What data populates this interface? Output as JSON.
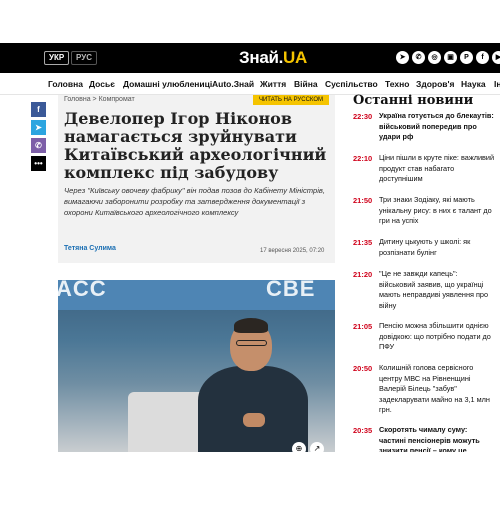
{
  "header": {
    "lang_active": "УКР",
    "lang_inactive": "РУС",
    "logo_main": "Знай.",
    "logo_accent": "UA",
    "social_icons": [
      "telegram-icon",
      "viber-icon",
      "instagram-icon",
      "flipboard-icon",
      "pinterest-icon",
      "facebook-icon",
      "youtube-icon"
    ]
  },
  "nav": {
    "items": [
      "Головна",
      "Досьє",
      "Домашні улюблениці",
      "Auto.Знай",
      "Життя",
      "Війна",
      "Суспільство",
      "Техно",
      "Здоров'я",
      "Наука",
      "Ін"
    ]
  },
  "share": {
    "icons": [
      "facebook-icon",
      "telegram-icon",
      "viber-icon",
      "more-icon"
    ],
    "colors": [
      "#3b5998",
      "#2ca5e0",
      "#7d5fa8",
      "#000000"
    ]
  },
  "article": {
    "breadcrumb_home": "Головна",
    "breadcrumb_sep": " > ",
    "breadcrumb_section": "Компромат",
    "ru_button": "ЧИТАТЬ НА РУССКОМ",
    "title": "Девелопер Ігор Ніконов намагається зруйнувати Китаївський археологічний комплекс під забудову",
    "lead": "Через \"Київську овочеву фабрику\" він подав позов до Кабінету Міністрів, вимагаючи заборонити розробку та затвердження документації з охорони Китаївського археологічного комплексу",
    "author": "Тетяна Сулима",
    "date": "17 вересня 2025, 07:20"
  },
  "news": {
    "heading": "Останні новини",
    "items": [
      {
        "time": "22:30",
        "text": "Україна готується до блекаутів: військовий попередив про удари рф",
        "bold": true
      },
      {
        "time": "22:10",
        "text": "Ціни пішли в круте піке: важливий продукт став набагато доступнішим",
        "bold": false
      },
      {
        "time": "21:50",
        "text": "Три знаки Зодіаку, які мають унікальну рису: в них є талант до гри на успіх",
        "bold": false
      },
      {
        "time": "21:35",
        "text": "Дитину цькують у школі: як розпізнати булінг",
        "bold": false
      },
      {
        "time": "21:20",
        "text": "\"Це не завжди капець\": військовий заявив, що українці мають неправдиві уявлення про війну",
        "bold": false
      },
      {
        "time": "21:05",
        "text": "Пенсію можна збільшити однією довідкою: що потрібно подати до ПФУ",
        "bold": false
      },
      {
        "time": "20:50",
        "text": "Колишній голова сервісного центру МВС на Рівненщині Валерій Білець \"забув\" задекларувати майно на 3,1 млн грн.",
        "bold": false
      },
      {
        "time": "20:35",
        "text": "Скоротять чималу суму: частині пенсіонерів можуть знизити пенсії – кому це",
        "bold": true
      }
    ]
  },
  "colors": {
    "accent_yellow": "#f5c400",
    "time_red": "#d0021b",
    "author_blue": "#1b6fb3"
  }
}
